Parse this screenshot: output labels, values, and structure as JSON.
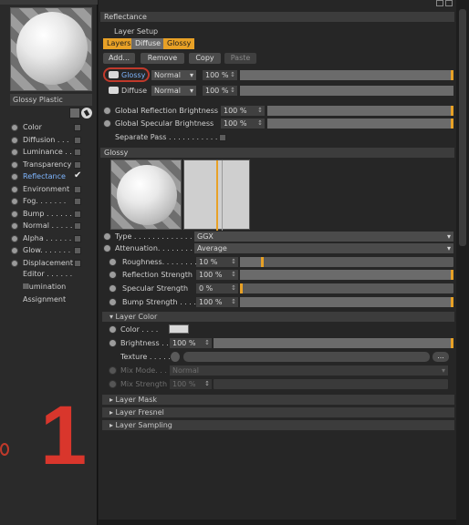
{
  "material_name": "Glossy Plastic",
  "channels": [
    {
      "label": "Color",
      "top": 0,
      "checked": false,
      "active": false
    },
    {
      "label": "Diffusion . . .",
      "checked": false,
      "active": false
    },
    {
      "label": "Luminance . . .",
      "checked": false,
      "active": false
    },
    {
      "label": "Transparency",
      "checked": false,
      "active": false
    },
    {
      "label": "Reflectance",
      "checked": true,
      "active": true
    },
    {
      "label": "Environment",
      "checked": false,
      "active": false
    },
    {
      "label": "Fog. . . . . . .",
      "checked": false,
      "active": false
    },
    {
      "label": "Bump . . . . . .",
      "checked": false,
      "active": false
    },
    {
      "label": "Normal . . . . .",
      "checked": false,
      "active": false
    },
    {
      "label": "Alpha . . . . . .",
      "checked": false,
      "active": false
    },
    {
      "label": "Glow. . . . . . .",
      "checked": false,
      "active": false
    },
    {
      "label": "Displacement",
      "checked": false,
      "active": false
    }
  ],
  "sub_items": [
    "Editor . . . . . .",
    "Illumination",
    "Assignment"
  ],
  "overlay_number": "1",
  "reflectance": {
    "header": "Reflectance",
    "layer_setup": "Layer Setup",
    "tabs": [
      "Layers",
      "Diffuse",
      "Glossy"
    ],
    "buttons": [
      "Add...",
      "Remove",
      "Copy",
      "Paste"
    ],
    "layers": [
      {
        "name": "Glossy",
        "mode": "Normal",
        "value": "100 %"
      },
      {
        "name": "Diffuse",
        "mode": "Normal",
        "value": "100 %"
      }
    ],
    "global_reflection_label": "Global Reflection Brightness",
    "global_reflection_value": "100 %",
    "global_specular_label": "Global Specular Brightness",
    "global_specular_value": "100 %",
    "separate_pass_label": "Separate Pass . . . . . . . . . . . ."
  },
  "glossy": {
    "header": "Glossy",
    "type_label": "Type . . . . . . . . . . . . . .",
    "type_value": "GGX",
    "attenuation_label": "Attenuation. . . . . . . . .",
    "attenuation_value": "Average",
    "roughness_label": "Roughness. . . . . . . .",
    "roughness_value": "10 %",
    "roughness_fraction": 0.1,
    "reflection_strength_label": "Reflection Strength",
    "reflection_strength_value": "100 %",
    "specular_strength_label": "Specular Strength",
    "specular_strength_value": "0 %",
    "bump_strength_label": "Bump Strength . . . .",
    "bump_strength_value": "100 %"
  },
  "layer_color": {
    "header": "▾ Layer Color",
    "color_label": "Color . . . .",
    "brightness_label": "Brightness . . .",
    "brightness_value": "100 %",
    "texture_label": "Texture . . . . . .",
    "texture_btn": "...",
    "mix_mode_label": "Mix Mode. . . . .",
    "mix_mode_value": "Normal",
    "mix_strength_label": "Mix Strength",
    "mix_strength_value": "100 %"
  },
  "collapsed": [
    "▸ Layer Mask",
    "▸ Layer Fresnel",
    "▸ Layer Sampling"
  ],
  "colors": {
    "accent": "#e8a126",
    "active_text": "#7fb6ff",
    "annotation": "#d9362c"
  }
}
